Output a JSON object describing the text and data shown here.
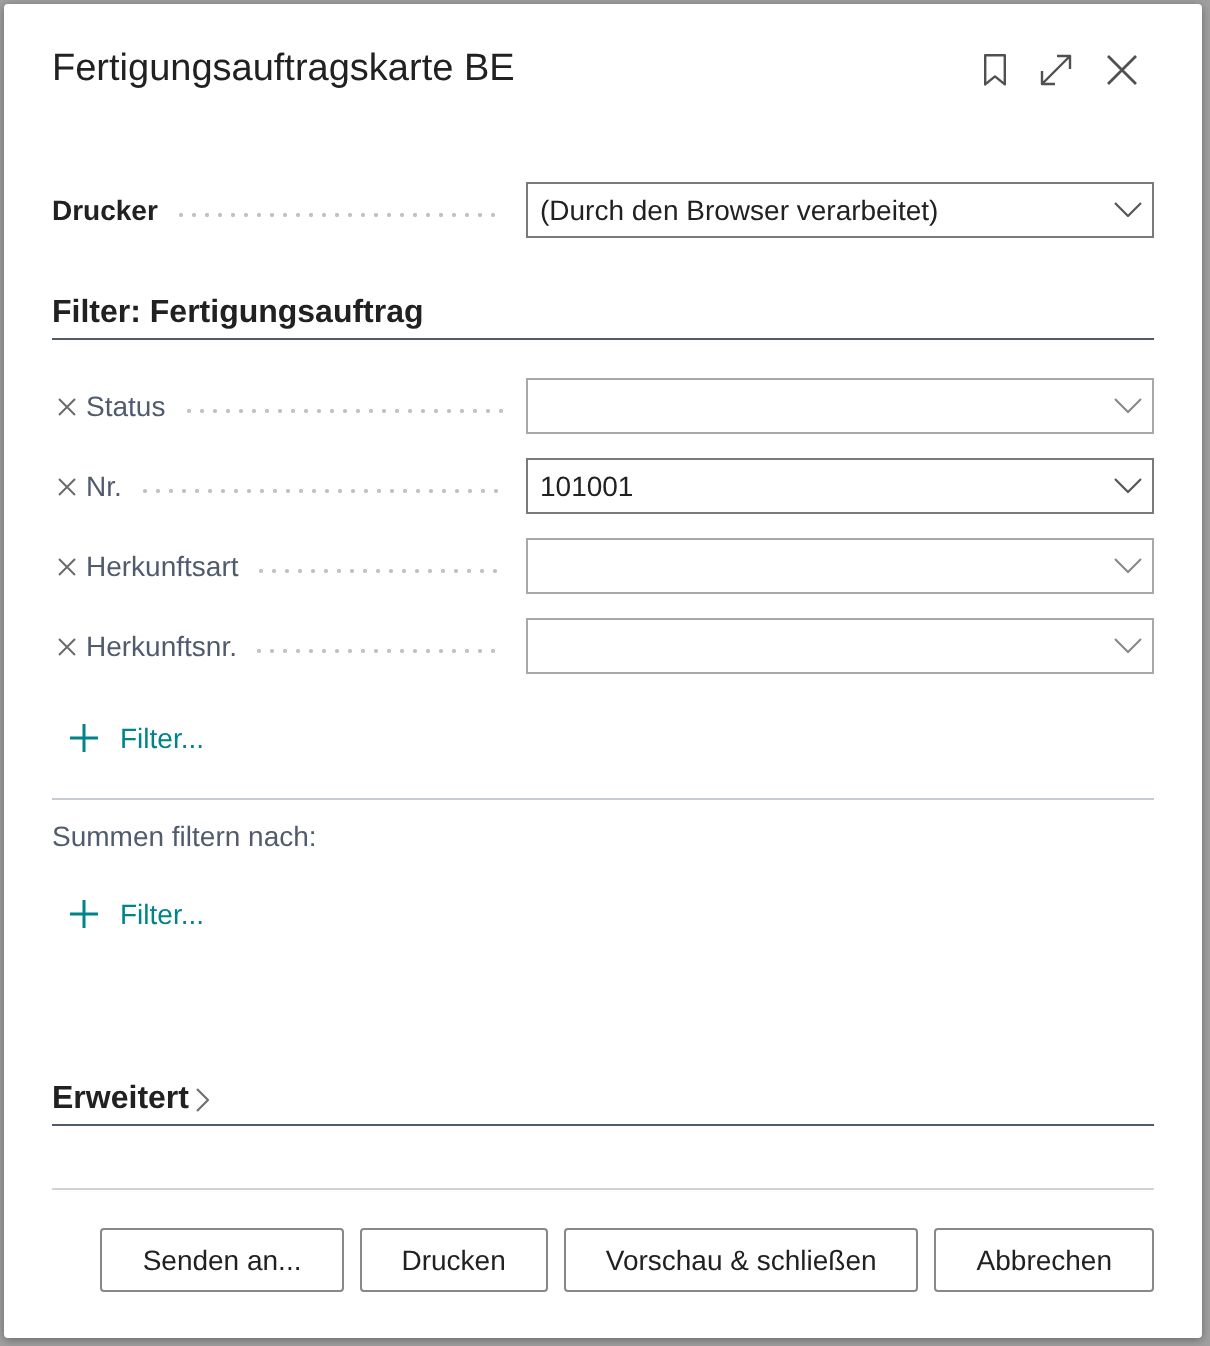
{
  "dialog": {
    "title": "Fertigungsauftragskarte BE"
  },
  "printer": {
    "label": "Drucker",
    "value": "(Durch den Browser verarbeitet)"
  },
  "filter_section": {
    "title": "Filter: Fertigungsauftrag",
    "fields": [
      {
        "label": "Status"
      },
      {
        "label": "Nr.",
        "value": "101001"
      },
      {
        "label": "Herkunftsart"
      },
      {
        "label": "Herkunftsnr."
      }
    ],
    "add_filter": "Filter..."
  },
  "totals_section": {
    "title": "Summen filtern nach:",
    "add_filter": "Filter..."
  },
  "advanced_section": {
    "title": "Erweitert",
    "expanded": false
  },
  "buttons": [
    "Senden an...",
    "Drucken",
    "Vorschau & schließen",
    "Abbrechen"
  ]
}
